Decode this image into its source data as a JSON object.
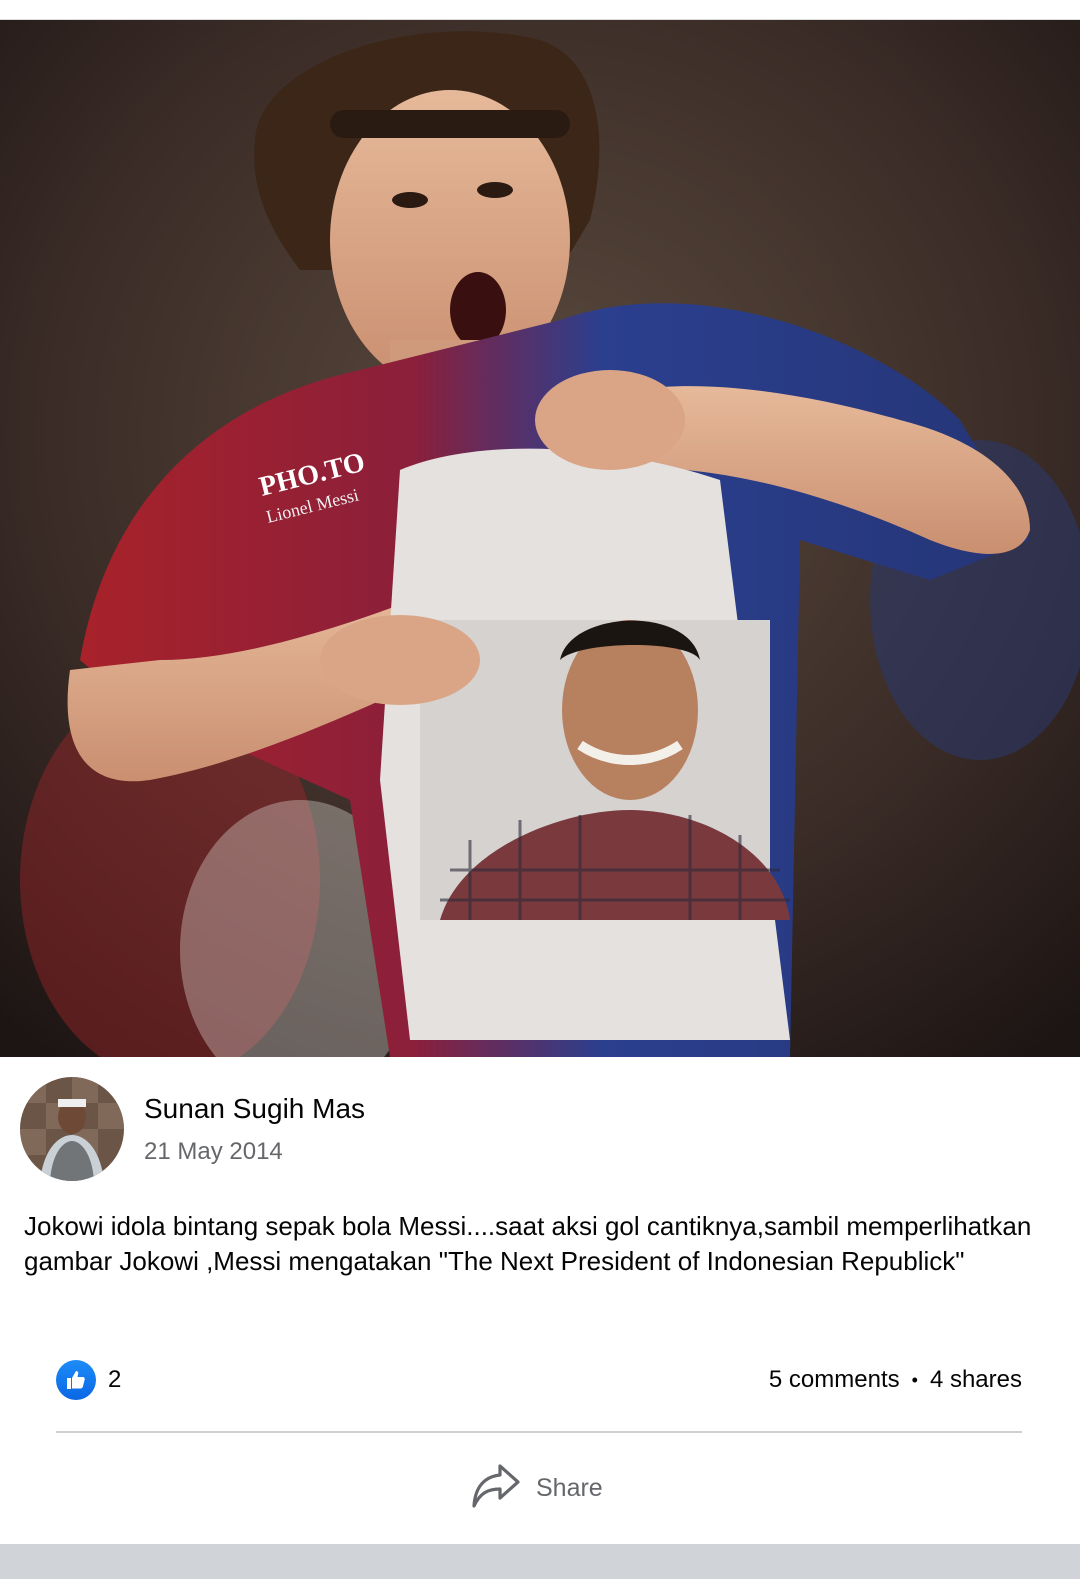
{
  "post": {
    "photo_alt": "",
    "author": {
      "name": "Sunan Sugih Mas",
      "date": "21 May 2014"
    },
    "text": "Jokowi idola bintang sepak bola Messi....saat aksi gol cantiknya,sambil memperlihatkan gambar Jokowi ,Messi mengatakan \"The Next President of Indonesian Republick\"",
    "reactions": {
      "icon": "like-icon",
      "count": "2"
    },
    "comments": "5 comments",
    "separator": "•",
    "shares": "4 shares",
    "actions": {
      "share_label": "Share",
      "share_icon": "share-arrow-icon"
    }
  },
  "colors": {
    "like_blue": "#1877f2",
    "secondary_text": "#65676b",
    "divider": "#ced0d4"
  }
}
